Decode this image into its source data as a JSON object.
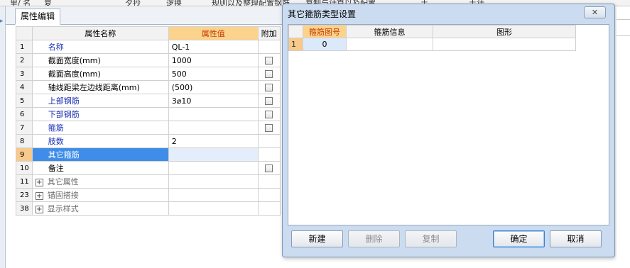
{
  "toolbar_fragments": [
    "里/ 名",
    "复   ",
    "夕抄",
    "逻换",
    "规则以及整理配置钢筋",
    "复制与计算以及配置",
    "土",
    "土计"
  ],
  "panel": {
    "tab_label": "属性编辑",
    "columns": {
      "name": "属性名称",
      "value": "属性值",
      "extra": "附加"
    },
    "rows": [
      {
        "num": "1",
        "name": "名称",
        "value": "QL-1",
        "check": false,
        "blue": true
      },
      {
        "num": "2",
        "name": "截面宽度(mm)",
        "value": "1000",
        "check": true,
        "blue": false
      },
      {
        "num": "3",
        "name": "截面高度(mm)",
        "value": "500",
        "check": true,
        "blue": false
      },
      {
        "num": "4",
        "name": "轴线距梁左边线距离(mm)",
        "value": "(500)",
        "check": true,
        "blue": false
      },
      {
        "num": "5",
        "name": "上部钢筋",
        "value": "3⌀10",
        "check": true,
        "blue": true
      },
      {
        "num": "6",
        "name": "下部钢筋",
        "value": "",
        "check": true,
        "blue": true
      },
      {
        "num": "7",
        "name": "箍筋",
        "value": "",
        "check": true,
        "blue": true
      },
      {
        "num": "8",
        "name": "肢数",
        "value": "2",
        "check": false,
        "blue": true
      },
      {
        "num": "9",
        "name": "其它箍筋",
        "value": "",
        "check": false,
        "blue": false,
        "selected": true
      },
      {
        "num": "10",
        "name": "备注",
        "value": "",
        "check": true,
        "blue": false
      },
      {
        "num": "11",
        "name": "其它属性",
        "value": "",
        "check": false,
        "group": true
      },
      {
        "num": "23",
        "name": "锚固搭接",
        "value": "",
        "check": false,
        "group": true
      },
      {
        "num": "38",
        "name": "显示样式",
        "value": "",
        "check": false,
        "group": true
      }
    ]
  },
  "dialog": {
    "title": "其它箍筋类型设置",
    "close_label": "✕",
    "columns": {
      "shape_no": "箍筋图号",
      "info": "箍筋信息",
      "figure": "图形"
    },
    "rows": [
      {
        "num": "1",
        "shape_no": "0",
        "info": "",
        "figure": ""
      }
    ],
    "buttons": {
      "new": "新建",
      "delete": "删除",
      "copy": "复制",
      "ok": "确定",
      "cancel": "取消"
    }
  },
  "colors": {
    "header_highlight": "#fbd38c",
    "selection": "#3f8de8",
    "dialog_bg": "#ccdcf0",
    "link_blue": "#1a2fb5"
  }
}
